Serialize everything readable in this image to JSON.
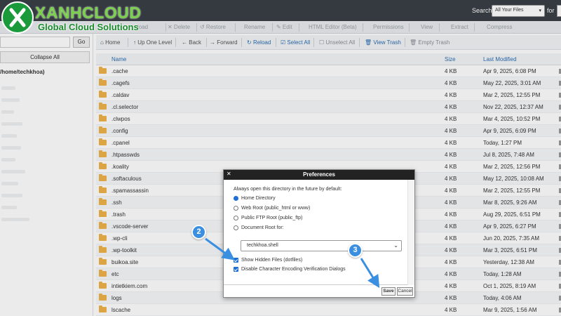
{
  "brand": {
    "name": "XANHCLOUD",
    "tagline": "Global Cloud Solutions",
    "logo_icon": "x-logo-icon",
    "color": "#1a9a3a"
  },
  "search": {
    "label": "Search",
    "scope": "All Your Files",
    "for_label": "for"
  },
  "toolbar_top": [
    {
      "label": "load",
      "icon": "upload-icon"
    },
    {
      "label": "✕ Delete",
      "icon": "close-icon"
    },
    {
      "label": "↺ Restore",
      "icon": "restore-icon"
    },
    {
      "label": "Rename",
      "icon": "rename-icon"
    },
    {
      "label": "✎ Edit",
      "icon": "pencil-icon"
    },
    {
      "label": "HTML Editor (Beta)",
      "icon": "html-icon"
    },
    {
      "label": "Permissions",
      "icon": "key-icon"
    },
    {
      "label": "View",
      "icon": "eye-icon"
    },
    {
      "label": "Extract",
      "icon": "extract-icon"
    },
    {
      "label": "Compress",
      "icon": "compress-icon"
    }
  ],
  "toolbar_nav": {
    "home": "Home",
    "up": "Up One Level",
    "back": "Back",
    "forward": "Forward",
    "reload": "Reload",
    "select_all": "Select All",
    "unselect_all": "Unselect All",
    "view_trash": "View Trash",
    "empty_trash": "Empty Trash"
  },
  "sidebar": {
    "go": "Go",
    "collapse_all": "Collapse All",
    "root": "/home/techkhoa)"
  },
  "table": {
    "headers": {
      "name": "Name",
      "size": "Size",
      "modified": "Last Modified"
    },
    "rows": [
      {
        "name": ".cache",
        "size": "4 KB",
        "date": "Apr 9, 2025, 6:08 PM"
      },
      {
        "name": ".cagefs",
        "size": "4 KB",
        "date": "May 22, 2025, 3:01 AM"
      },
      {
        "name": ".caldav",
        "size": "4 KB",
        "date": "Mar 2, 2025, 12:55 PM"
      },
      {
        "name": ".cl.selector",
        "size": "4 KB",
        "date": "Nov 22, 2025, 12:37 AM"
      },
      {
        "name": ".clwpos",
        "size": "4 KB",
        "date": "Mar 4, 2025, 10:52 PM"
      },
      {
        "name": ".config",
        "size": "4 KB",
        "date": "Apr 9, 2025, 6:09 PM"
      },
      {
        "name": ".cpanel",
        "size": "4 KB",
        "date": "Today, 1:27 PM"
      },
      {
        "name": ".htpasswds",
        "size": "4 KB",
        "date": "Jul 8, 2025, 7:48 AM"
      },
      {
        "name": ".koality",
        "size": "4 KB",
        "date": "Mar 2, 2025, 12:56 PM"
      },
      {
        "name": ".softaculous",
        "size": "4 KB",
        "date": "May 12, 2025, 10:08 AM"
      },
      {
        "name": ".spamassassin",
        "size": "4 KB",
        "date": "Mar 2, 2025, 12:55 PM"
      },
      {
        "name": ".ssh",
        "size": "4 KB",
        "date": "Mar 8, 2025, 9:26 AM"
      },
      {
        "name": ".trash",
        "size": "4 KB",
        "date": "Aug 29, 2025, 6:51 PM"
      },
      {
        "name": ".vscode-server",
        "size": "4 KB",
        "date": "Apr 9, 2025, 6:27 PM"
      },
      {
        "name": ".wp-cli",
        "size": "4 KB",
        "date": "Jun 20, 2025, 7:35 AM"
      },
      {
        "name": ".wp-toolkit",
        "size": "4 KB",
        "date": "Mar 3, 2025, 6:51 PM"
      },
      {
        "name": "buikoa.site",
        "size": "4 KB",
        "date": "Yesterday, 12:38 AM"
      },
      {
        "name": "etc",
        "size": "4 KB",
        "date": "Today, 1:28 AM"
      },
      {
        "name": "intietkiem.com",
        "size": "4 KB",
        "date": "Oct 1, 2025, 8:19 AM"
      },
      {
        "name": "logs",
        "size": "4 KB",
        "date": "Today, 4:06 AM"
      },
      {
        "name": "lscache",
        "size": "4 KB",
        "date": "Mar 9, 2025, 1:56 AM"
      }
    ]
  },
  "modal": {
    "title": "Preferences",
    "description": "Always open this directory in the future by default:",
    "options": [
      {
        "label": "Home Directory",
        "selected": true
      },
      {
        "label": "Web Root (public_html or www)",
        "selected": false
      },
      {
        "label": "Public FTP Root (public_ftp)",
        "selected": false
      },
      {
        "label": "Document Root for:",
        "selected": false
      }
    ],
    "docroot_value": "techkhoa.shell",
    "checkboxes": [
      {
        "label": "Show Hidden Files (dotfiles)",
        "checked": true
      },
      {
        "label": "Disable Character Encoding Verification Dialogs",
        "checked": true
      }
    ],
    "save": "Save",
    "cancel": "Cancel"
  },
  "steps": {
    "two": "2",
    "three": "3"
  },
  "colors": {
    "accent": "#2a6db3",
    "step": "#3b8fe0",
    "folder": "#f0b24a"
  }
}
